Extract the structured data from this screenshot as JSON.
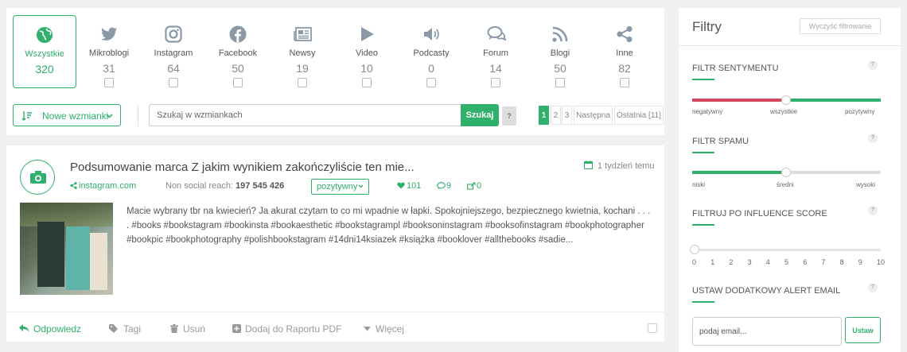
{
  "sources": {
    "tiles": [
      {
        "name": "Wszystkie",
        "count": "320",
        "icon": "globe-icon",
        "active": true
      },
      {
        "name": "Mikroblogi",
        "count": "31",
        "icon": "twitter-icon"
      },
      {
        "name": "Instagram",
        "count": "64",
        "icon": "instagram-icon"
      },
      {
        "name": "Facebook",
        "count": "50",
        "icon": "facebook-icon"
      },
      {
        "name": "Newsy",
        "count": "19",
        "icon": "newspaper-icon"
      },
      {
        "name": "Video",
        "count": "10",
        "icon": "play-icon"
      },
      {
        "name": "Podcasty",
        "count": "0",
        "icon": "speaker-icon"
      },
      {
        "name": "Forum",
        "count": "14",
        "icon": "chat-icon"
      },
      {
        "name": "Blogi",
        "count": "50",
        "icon": "rss-icon"
      },
      {
        "name": "Inne",
        "count": "82",
        "icon": "share-icon"
      }
    ]
  },
  "toolbar": {
    "sort_label": "Nowe wzmianki",
    "search_placeholder": "Szukaj w wzmiankach",
    "search_button": "Szukaj",
    "help": "?",
    "pages": [
      "1",
      "2",
      "3"
    ],
    "next": "Następna",
    "last": "Ostatnia [11]"
  },
  "mention": {
    "title": "Podsumowanie marca Z jakim wynikiem zakończyliście ten mie...",
    "date": "1 tydzień temu",
    "domain": "instagram.com",
    "reach_label": "Non social reach:",
    "reach_value": "197 545 426",
    "sentiment": "pozytywny",
    "likes": "101",
    "comments": "9",
    "shares": "0",
    "text": "Macie wybrany tbr na kwiecień? Ja akurat czytam to co mi wpadnie w łapki. Spokojniejszego, bezpiecznego kwietnia, kochani . . . . #books #bookstagram #bookinsta #bookaesthetic #bookstagrampl #booksoninstagram #booksofinstagram #bookphotographer #bookpic #bookphotography #polishbookstagram #14dni14ksiazek #książka #booklover #allthebooks #sadie..."
  },
  "actions": {
    "reply": "Odpowiedz",
    "tags": "Tagi",
    "delete": "Usuń",
    "add_pdf": "Dodaj do Raportu PDF",
    "more": "Więcej"
  },
  "filters": {
    "title": "Filtry",
    "clear": "Wyczyść filtrowanie",
    "sentiment": {
      "heading": "FILTR SENTYMENTU",
      "labels": [
        "negatywny",
        "wszystkie",
        "pozytywny"
      ],
      "value_fraction": 0.5
    },
    "spam": {
      "heading": "FILTR SPAMU",
      "labels": [
        "niski",
        "średni",
        "wysoki"
      ],
      "value_fraction": 0.5
    },
    "influence": {
      "heading": "FILTRUJ PO INFLUENCE SCORE",
      "ticks": [
        "0",
        "1",
        "2",
        "3",
        "4",
        "5",
        "6",
        "7",
        "8",
        "9",
        "10"
      ],
      "value": 0
    },
    "email": {
      "heading": "USTAW DODATKOWY ALERT EMAIL",
      "placeholder": "podaj email...",
      "button": "Ustaw"
    },
    "help": "?"
  },
  "colors": {
    "accent": "#2fb06b",
    "negative": "#d64561",
    "muted_icon": "#8a99a8"
  }
}
